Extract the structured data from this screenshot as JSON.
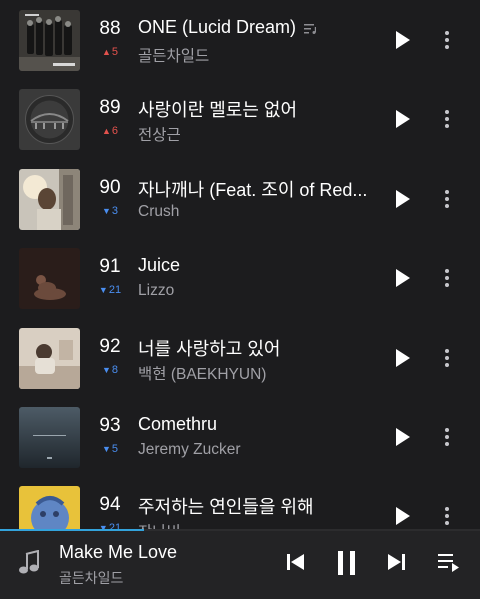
{
  "chart": {
    "tracks": [
      {
        "rank": "88",
        "title": "ONE (Lucid Dream)",
        "artist": "골든차일드",
        "change": "5",
        "direction": "up",
        "has_lyrics_icon": true
      },
      {
        "rank": "89",
        "title": "사랑이란 멜로는 없어",
        "artist": "전상근",
        "change": "6",
        "direction": "up"
      },
      {
        "rank": "90",
        "title": "자나깨나 (Feat. 조이 of Red...",
        "artist": "Crush",
        "change": "3",
        "direction": "down"
      },
      {
        "rank": "91",
        "title": "Juice",
        "artist": "Lizzo",
        "change": "21",
        "direction": "down"
      },
      {
        "rank": "92",
        "title": "너를 사랑하고 있어",
        "artist": "백현 (BAEKHYUN)",
        "change": "8",
        "direction": "down"
      },
      {
        "rank": "93",
        "title": "Comethru",
        "artist": "Jeremy Zucker",
        "change": "5",
        "direction": "down"
      },
      {
        "rank": "94",
        "title": "주저하는 연인들을 위해",
        "artist": "잔나비",
        "change": "21",
        "direction": "down"
      }
    ]
  },
  "now_playing": {
    "title": "Make Me Love",
    "artist": "골든차일드",
    "progress": 0.3,
    "icons": {
      "note": "music-note-icon",
      "prev": "skip-previous-icon",
      "pause": "pause-icon",
      "next": "skip-next-icon",
      "queue": "playlist-queue-icon"
    }
  },
  "colors": {
    "background": "#1c1c1e",
    "rank_up": "#e3524d",
    "rank_down": "#4a8ef0",
    "progress": "#33a3dc"
  }
}
